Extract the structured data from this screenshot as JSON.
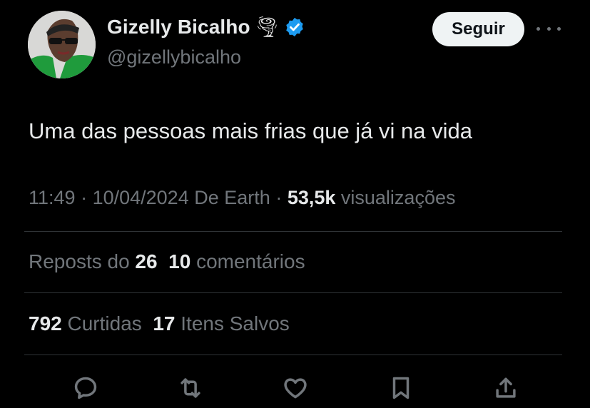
{
  "author": {
    "name": "Gizelly Bicalho",
    "handle": "@gizellybicalho",
    "emoji": "🌪",
    "verified_color": "#1d9bf0"
  },
  "header": {
    "follow_label": "Seguir",
    "more_icon": "more-horizontal-icon"
  },
  "tweet": {
    "text": "Uma das pessoas mais frias que já vi na vida"
  },
  "meta": {
    "time": "11:49",
    "date": "10/04/2024",
    "source": "De Earth",
    "views_count": "53,5k",
    "views_label": "visualizações"
  },
  "stats": {
    "reposts_label": "Reposts do",
    "reposts_count": "26",
    "comments_count": "10",
    "comments_label": "comentários",
    "likes_count": "792",
    "likes_label": "Curtidas",
    "saves_count": "17",
    "saves_label": "Itens Salvos"
  },
  "actions": [
    "reply-icon",
    "repost-icon",
    "like-icon",
    "bookmark-icon",
    "share-icon"
  ],
  "colors": {
    "background": "#000000",
    "text": "#e7e9ea",
    "muted": "#71767b",
    "verified": "#1d9bf0"
  }
}
